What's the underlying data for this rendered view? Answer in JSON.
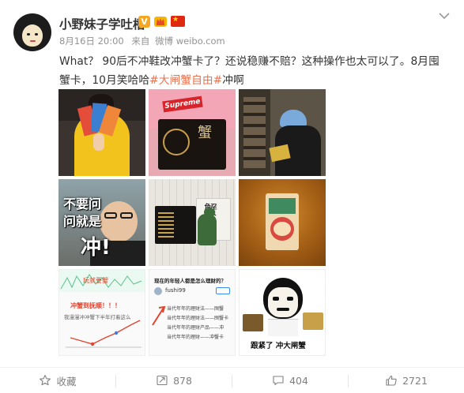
{
  "post": {
    "username": "小野妹子学吐槽",
    "verified_badge": "V",
    "meta": {
      "date": "8月16日 20:00",
      "source_prefix": "来自",
      "source": "微博 weibo.com"
    },
    "text_before": "What？ 90后不冲鞋改冲蟹卡了？还说稳赚不赔？这种操作也太可以了。8月囤蟹卡，10月笑哈哈",
    "hashtag": "#大闸蟹自由#",
    "text_after": "冲啊"
  },
  "thumbnails": {
    "t2_label": "Supreme",
    "t4_line1": "不要问",
    "t4_line2": "问就是",
    "t4_line3": "冲!",
    "t7_header": "玩就要蟹",
    "t7_label": "冲蟹到抚顺！！！",
    "t7_sub": "我漫漫冲冲蟹下半年打着这么",
    "t8_header": "现在的年轻人都是怎么理财的？",
    "t8_user": "fushi99",
    "t8_line1": "当代年年的理财法——囤蟹",
    "t8_line2": "当代年年的理财法——囤蟹卡",
    "t8_line3": "当代年年的理财产品——冲",
    "t8_line4": "当代年年的理财——冲蟹卡",
    "t9_caption": "跟紧了 冲大闸蟹"
  },
  "actions": {
    "favorite_label": "收藏",
    "repost_count": "878",
    "comment_count": "404",
    "like_count": "2721"
  },
  "colors": {
    "hashtag": "#eb7350",
    "meta": "#939393",
    "action_text": "#808080",
    "flag": "#de2910",
    "badge": "#f5a623"
  },
  "icons": [
    "avatar",
    "verified-badge-icon",
    "crown-badge-icon",
    "flag-badge-icon",
    "chevron-down-icon",
    "star-icon",
    "repost-icon",
    "comment-icon",
    "like-icon"
  ]
}
